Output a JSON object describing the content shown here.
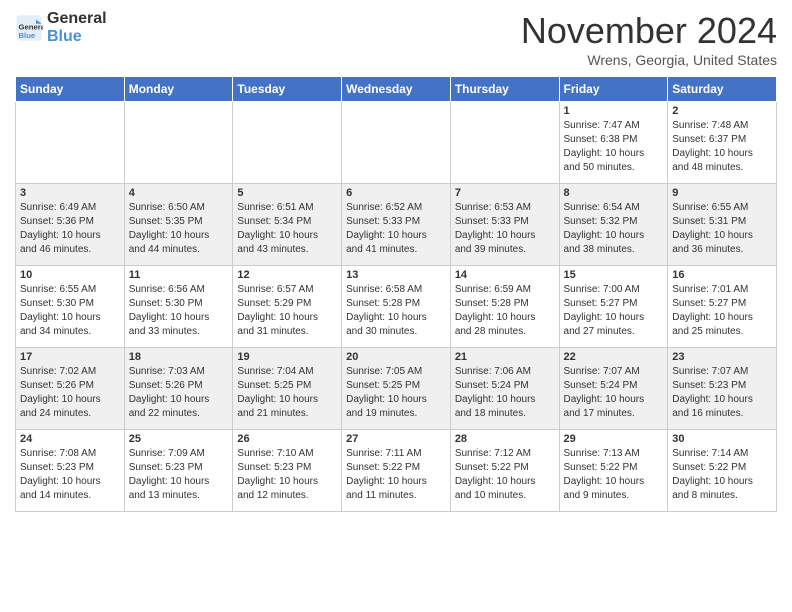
{
  "header": {
    "logo_line1": "General",
    "logo_line2": "Blue",
    "month": "November 2024",
    "location": "Wrens, Georgia, United States"
  },
  "days_of_week": [
    "Sunday",
    "Monday",
    "Tuesday",
    "Wednesday",
    "Thursday",
    "Friday",
    "Saturday"
  ],
  "weeks": [
    [
      {
        "day": "",
        "info": ""
      },
      {
        "day": "",
        "info": ""
      },
      {
        "day": "",
        "info": ""
      },
      {
        "day": "",
        "info": ""
      },
      {
        "day": "",
        "info": ""
      },
      {
        "day": "1",
        "info": "Sunrise: 7:47 AM\nSunset: 6:38 PM\nDaylight: 10 hours\nand 50 minutes."
      },
      {
        "day": "2",
        "info": "Sunrise: 7:48 AM\nSunset: 6:37 PM\nDaylight: 10 hours\nand 48 minutes."
      }
    ],
    [
      {
        "day": "3",
        "info": "Sunrise: 6:49 AM\nSunset: 5:36 PM\nDaylight: 10 hours\nand 46 minutes."
      },
      {
        "day": "4",
        "info": "Sunrise: 6:50 AM\nSunset: 5:35 PM\nDaylight: 10 hours\nand 44 minutes."
      },
      {
        "day": "5",
        "info": "Sunrise: 6:51 AM\nSunset: 5:34 PM\nDaylight: 10 hours\nand 43 minutes."
      },
      {
        "day": "6",
        "info": "Sunrise: 6:52 AM\nSunset: 5:33 PM\nDaylight: 10 hours\nand 41 minutes."
      },
      {
        "day": "7",
        "info": "Sunrise: 6:53 AM\nSunset: 5:33 PM\nDaylight: 10 hours\nand 39 minutes."
      },
      {
        "day": "8",
        "info": "Sunrise: 6:54 AM\nSunset: 5:32 PM\nDaylight: 10 hours\nand 38 minutes."
      },
      {
        "day": "9",
        "info": "Sunrise: 6:55 AM\nSunset: 5:31 PM\nDaylight: 10 hours\nand 36 minutes."
      }
    ],
    [
      {
        "day": "10",
        "info": "Sunrise: 6:55 AM\nSunset: 5:30 PM\nDaylight: 10 hours\nand 34 minutes."
      },
      {
        "day": "11",
        "info": "Sunrise: 6:56 AM\nSunset: 5:30 PM\nDaylight: 10 hours\nand 33 minutes."
      },
      {
        "day": "12",
        "info": "Sunrise: 6:57 AM\nSunset: 5:29 PM\nDaylight: 10 hours\nand 31 minutes."
      },
      {
        "day": "13",
        "info": "Sunrise: 6:58 AM\nSunset: 5:28 PM\nDaylight: 10 hours\nand 30 minutes."
      },
      {
        "day": "14",
        "info": "Sunrise: 6:59 AM\nSunset: 5:28 PM\nDaylight: 10 hours\nand 28 minutes."
      },
      {
        "day": "15",
        "info": "Sunrise: 7:00 AM\nSunset: 5:27 PM\nDaylight: 10 hours\nand 27 minutes."
      },
      {
        "day": "16",
        "info": "Sunrise: 7:01 AM\nSunset: 5:27 PM\nDaylight: 10 hours\nand 25 minutes."
      }
    ],
    [
      {
        "day": "17",
        "info": "Sunrise: 7:02 AM\nSunset: 5:26 PM\nDaylight: 10 hours\nand 24 minutes."
      },
      {
        "day": "18",
        "info": "Sunrise: 7:03 AM\nSunset: 5:26 PM\nDaylight: 10 hours\nand 22 minutes."
      },
      {
        "day": "19",
        "info": "Sunrise: 7:04 AM\nSunset: 5:25 PM\nDaylight: 10 hours\nand 21 minutes."
      },
      {
        "day": "20",
        "info": "Sunrise: 7:05 AM\nSunset: 5:25 PM\nDaylight: 10 hours\nand 19 minutes."
      },
      {
        "day": "21",
        "info": "Sunrise: 7:06 AM\nSunset: 5:24 PM\nDaylight: 10 hours\nand 18 minutes."
      },
      {
        "day": "22",
        "info": "Sunrise: 7:07 AM\nSunset: 5:24 PM\nDaylight: 10 hours\nand 17 minutes."
      },
      {
        "day": "23",
        "info": "Sunrise: 7:07 AM\nSunset: 5:23 PM\nDaylight: 10 hours\nand 16 minutes."
      }
    ],
    [
      {
        "day": "24",
        "info": "Sunrise: 7:08 AM\nSunset: 5:23 PM\nDaylight: 10 hours\nand 14 minutes."
      },
      {
        "day": "25",
        "info": "Sunrise: 7:09 AM\nSunset: 5:23 PM\nDaylight: 10 hours\nand 13 minutes."
      },
      {
        "day": "26",
        "info": "Sunrise: 7:10 AM\nSunset: 5:23 PM\nDaylight: 10 hours\nand 12 minutes."
      },
      {
        "day": "27",
        "info": "Sunrise: 7:11 AM\nSunset: 5:22 PM\nDaylight: 10 hours\nand 11 minutes."
      },
      {
        "day": "28",
        "info": "Sunrise: 7:12 AM\nSunset: 5:22 PM\nDaylight: 10 hours\nand 10 minutes."
      },
      {
        "day": "29",
        "info": "Sunrise: 7:13 AM\nSunset: 5:22 PM\nDaylight: 10 hours\nand 9 minutes."
      },
      {
        "day": "30",
        "info": "Sunrise: 7:14 AM\nSunset: 5:22 PM\nDaylight: 10 hours\nand 8 minutes."
      }
    ]
  ]
}
